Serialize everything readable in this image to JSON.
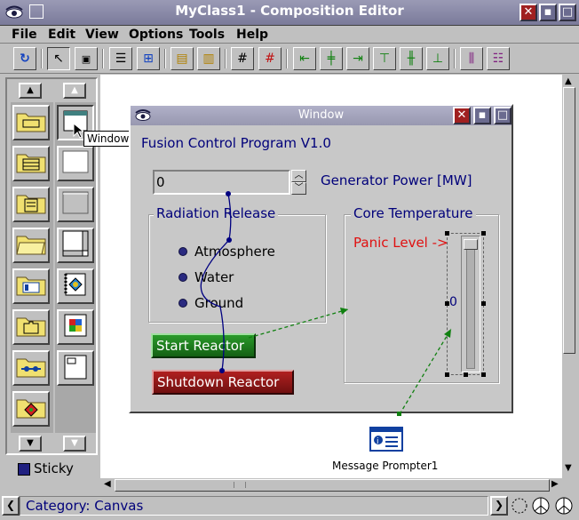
{
  "app": {
    "title": "MyClass1 - Composition Editor",
    "colors": {
      "titlebar": "#8080a0",
      "accent": "#00007a",
      "green_button": "#1d7a1d",
      "red_button": "#8b1a1a"
    }
  },
  "menu": [
    "File",
    "Edit",
    "View",
    "Options",
    "Tools",
    "Help"
  ],
  "toolbar_icons": [
    "refresh-icon",
    "pointer-icon",
    "parts-icon",
    "beans-list-icon",
    "tree-icon",
    "tearoff-icon",
    "property-icon",
    "grid-icon",
    "grid-red-icon",
    "align-left-icon",
    "align-center-icon",
    "align-right-icon",
    "align-top-icon",
    "align-middle-icon",
    "align-bottom-icon",
    "distribute-h-icon",
    "distribute-v-icon"
  ],
  "palette": {
    "tooltip": "Window",
    "sticky_label": "Sticky"
  },
  "window": {
    "title": "Window",
    "heading": "Fusion Control Program V1.0",
    "power_value": "0",
    "power_label": "Generator Power [MW]",
    "radiation": {
      "title": "Radiation Release",
      "options": [
        "Atmosphere",
        "Water",
        "Ground"
      ]
    },
    "core": {
      "title": "Core Temperature",
      "panic_label": "Panic Level ->",
      "slider_value": "0"
    },
    "start_label": "Start Reactor",
    "shutdown_label": "Shutdown Reactor"
  },
  "prompter_label": "Message Prompter1",
  "status": {
    "text": "Category: Canvas"
  }
}
